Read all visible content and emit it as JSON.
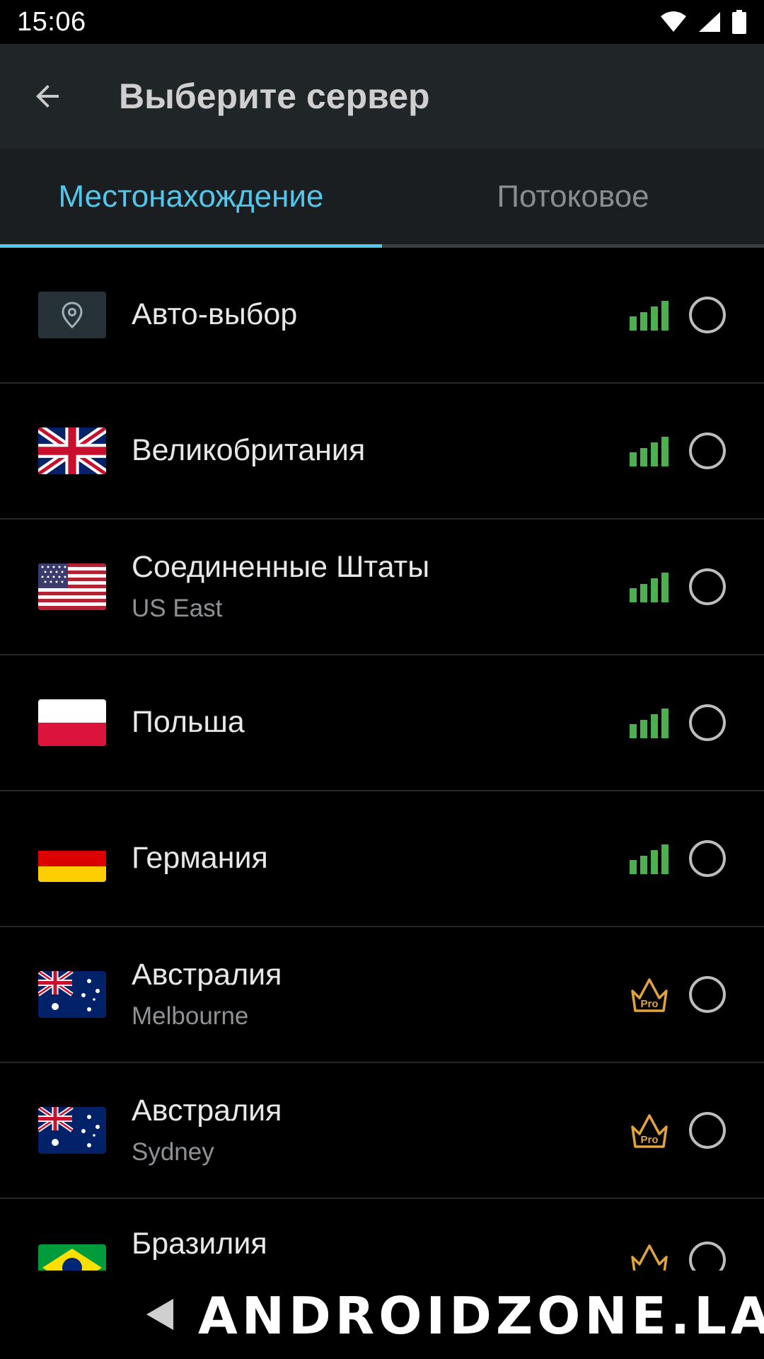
{
  "status_bar": {
    "time": "15:06"
  },
  "app_bar": {
    "title": "Выберите сервер"
  },
  "tabs": [
    {
      "label": "Местонахождение",
      "active": true
    },
    {
      "label": "Потоковое",
      "active": false
    }
  ],
  "servers": [
    {
      "flag": "auto-location",
      "name": "Авто-выбор",
      "sub": "",
      "indicator": "signal"
    },
    {
      "flag": "uk",
      "name": "Великобритания",
      "sub": "",
      "indicator": "signal"
    },
    {
      "flag": "us",
      "name": "Соединенные Штаты",
      "sub": "US East",
      "indicator": "signal"
    },
    {
      "flag": "pl",
      "name": "Польша",
      "sub": "",
      "indicator": "signal"
    },
    {
      "flag": "de",
      "name": "Германия",
      "sub": "",
      "indicator": "signal"
    },
    {
      "flag": "au",
      "name": "Австралия",
      "sub": "Melbourne",
      "indicator": "pro"
    },
    {
      "flag": "au",
      "name": "Австралия",
      "sub": "Sydney",
      "indicator": "pro"
    },
    {
      "flag": "br",
      "name": "Бразилия",
      "sub": "",
      "indicator": "pro"
    }
  ],
  "pro_badge_text": "Pro",
  "watermark": "ANDROIDZONE.LAT",
  "colors": {
    "accent": "#54c6eb",
    "signal": "#4caf50",
    "pro": "#e0a43c"
  }
}
